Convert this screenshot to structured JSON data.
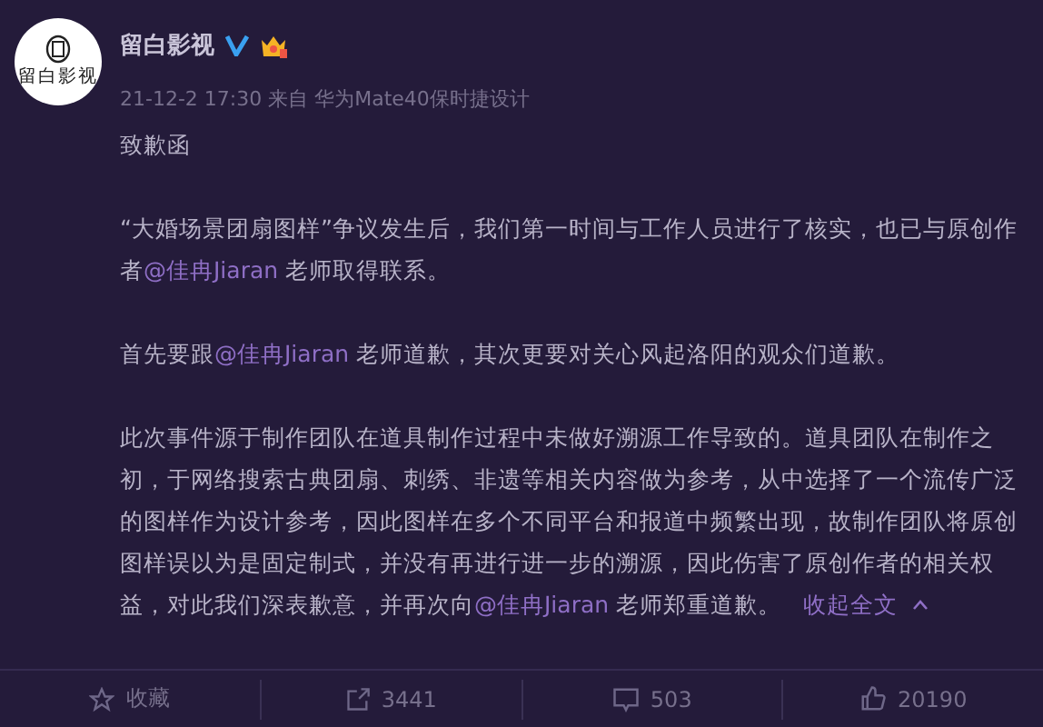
{
  "post": {
    "avatar_label": "留白影视",
    "author": "留白影视",
    "verified": true,
    "meta": "21-12-2 17:30 来自 华为Mate40保时捷设计",
    "paragraphs": [
      [
        {
          "kind": "text",
          "text": "致歉函"
        }
      ],
      [
        {
          "kind": "text",
          "text": "“大婚场景团扇图样”争议发生后，我们第一时间与工作人员进行了核实，也已与原创作者"
        },
        {
          "kind": "mention",
          "text": "@佳冉Jiaran"
        },
        {
          "kind": "text",
          "text": " 老师取得联系。"
        }
      ],
      [
        {
          "kind": "text",
          "text": "首先要跟"
        },
        {
          "kind": "mention",
          "text": "@佳冉Jiaran"
        },
        {
          "kind": "text",
          "text": " 老师道歉，其次更要对关心风起洛阳的观众们道歉。"
        }
      ],
      [
        {
          "kind": "text",
          "text": "此次事件源于制作团队在道具制作过程中未做好溯源工作导致的。道具团队在制作之初，于网络搜索古典团扇、刺绣、非遗等相关内容做为参考，从中选择了一个流传广泛的图样作为设计参考，因此图样在多个不同平台和报道中频繁出现，故制作团队将原创图样误以为是固定制式，并没有再进行进一步的溯源，因此伤害了原创作者的相关权益，对此我们深表歉意，并再次向"
        },
        {
          "kind": "mention",
          "text": "@佳冉Jiaran"
        },
        {
          "kind": "text",
          "text": " 老师郑重道歉。"
        },
        {
          "kind": "collapse",
          "text": "收起全文"
        }
      ]
    ],
    "actions": [
      {
        "kind": "star",
        "label": "收藏"
      },
      {
        "kind": "share",
        "label": "3441"
      },
      {
        "kind": "comment",
        "label": "503"
      },
      {
        "kind": "like",
        "label": "20190"
      }
    ]
  }
}
